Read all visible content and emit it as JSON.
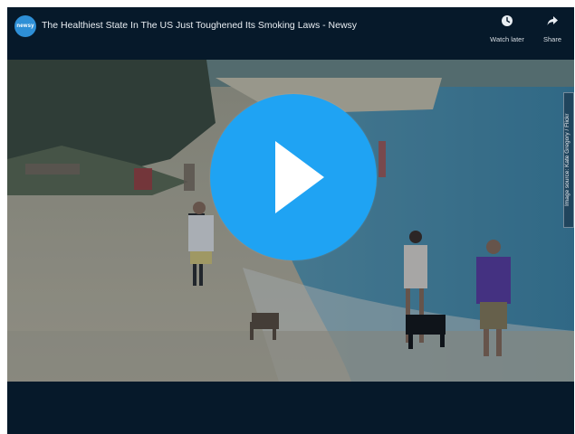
{
  "player": {
    "channel_logo_text": "newsy",
    "title": "The Healthiest State In The US Just Toughened Its Smoking Laws - Newsy",
    "actions": {
      "watch_later": {
        "label": "Watch later",
        "icon": "clock-icon"
      },
      "share": {
        "label": "Share",
        "icon": "share-arrow-icon"
      }
    },
    "side_credit": "Image source: Kate Gregory / Flickr",
    "play_icon": "play-icon",
    "colors": {
      "play_button": "#1fa3f3",
      "bar_background": "#06192a"
    }
  }
}
